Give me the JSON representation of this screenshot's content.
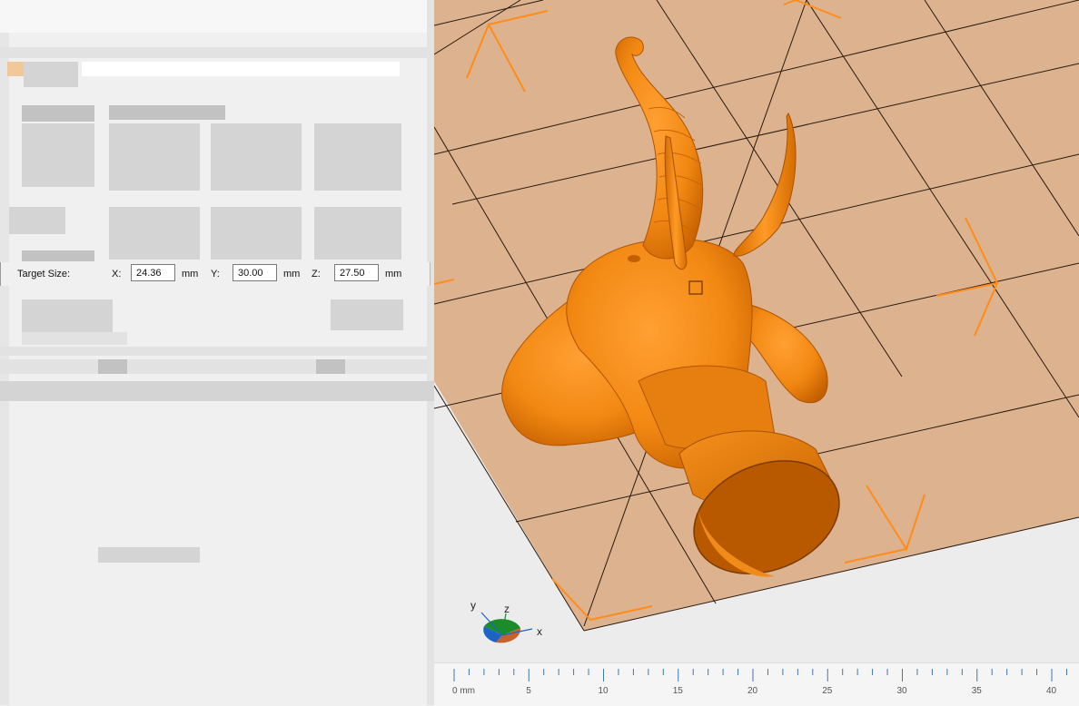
{
  "target_size": {
    "label": "Target Size:",
    "x_label": "X:",
    "x_value": "24.36",
    "y_label": "Y:",
    "y_value": "30.00",
    "z_label": "Z:",
    "z_value": "27.50",
    "unit": "mm"
  },
  "axes": {
    "x": "x",
    "y": "y",
    "z": "z"
  },
  "ruler": {
    "start_label": "0 mm",
    "labels": [
      "5",
      "10",
      "15",
      "20",
      "25",
      "30",
      "35",
      "40"
    ]
  },
  "colors": {
    "model": "#ff8c1a",
    "bed": "#ddb28e",
    "selection_corners": "#ff8c1a"
  }
}
